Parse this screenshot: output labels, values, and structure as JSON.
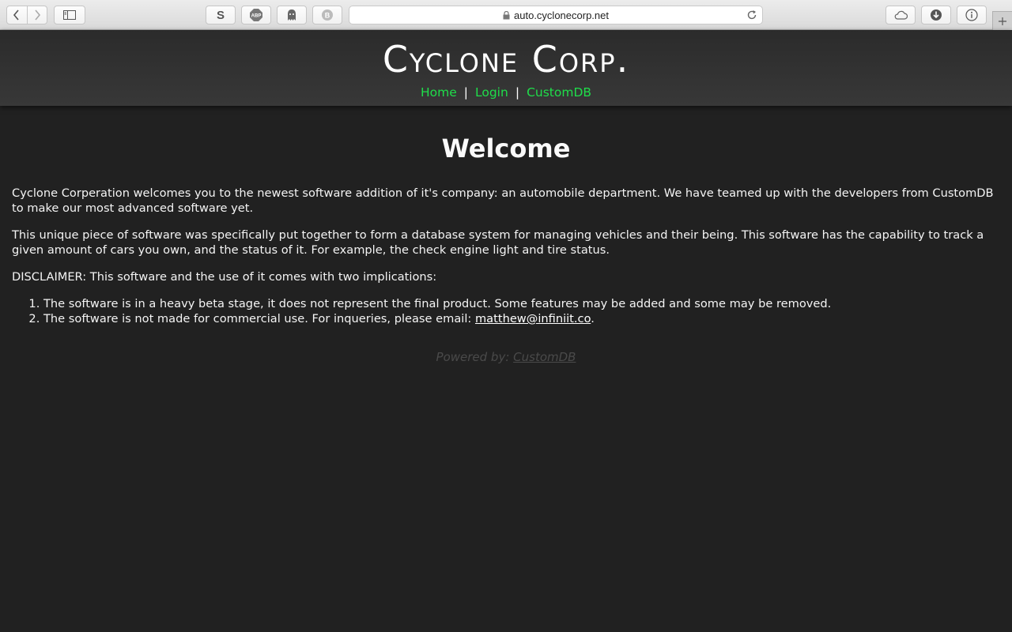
{
  "browser": {
    "url": "auto.cyclonecorp.net",
    "extensions": [
      "S",
      "ABP",
      "ghost",
      "B"
    ]
  },
  "site": {
    "title": "Cyclone Corp.",
    "nav": [
      {
        "label": "Home"
      },
      {
        "label": "Login"
      },
      {
        "label": "CustomDB"
      }
    ],
    "nav_separator": "|",
    "link_color": "#1fde4a"
  },
  "main": {
    "heading": "Welcome",
    "paragraphs": [
      "Cyclone Corperation welcomes you to the newest software addition of it's company: an automobile department. We have teamed up with the developers from CustomDB to make our most advanced software yet.",
      "This unique piece of software was specifically put together to form a database system for managing vehicles and their being. This software has the capability to track a given amount of cars you own, and the status of it. For example, the check engine light and tire status.",
      "DISCLAIMER: This software and the use of it comes with two implications:"
    ],
    "list": [
      {
        "text": "The software is in a heavy beta stage, it does not represent the final product. Some features may be added and some may be removed."
      },
      {
        "text": "The software is not made for commercial use. For inqueries, please email: ",
        "email": "matthew@infiniit.co",
        "suffix": "."
      }
    ],
    "powered_prefix": "Powered by: ",
    "powered_link": "CustomDB"
  }
}
